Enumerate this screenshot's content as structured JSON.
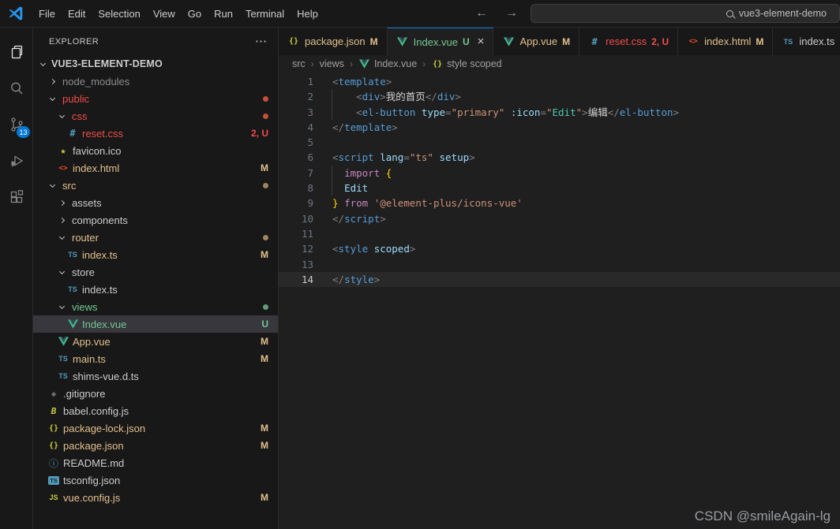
{
  "colors": {
    "accent_blue": "#0078d4",
    "git_modified": "#e2c08d",
    "git_untracked": "#73c991",
    "error_red": "#f14c4c",
    "vue_green": "#41b883"
  },
  "title_bar": {
    "menus": [
      "File",
      "Edit",
      "Selection",
      "View",
      "Go",
      "Run",
      "Terminal",
      "Help"
    ],
    "back_arrow": "←",
    "forward_arrow": "→",
    "search_text": "vue3-element-demo"
  },
  "activity_bar": {
    "source_control_badge": "13"
  },
  "explorer": {
    "header": "EXPLORER",
    "actions": "⋯",
    "root": "VUE3-ELEMENT-DEMO",
    "items": [
      {
        "label": "node_modules",
        "type": "folder",
        "expanded": false,
        "level": 1,
        "color": "gray"
      },
      {
        "label": "public",
        "type": "folder",
        "expanded": true,
        "level": 1,
        "color": "red",
        "dot": "red"
      },
      {
        "label": "css",
        "type": "folder",
        "expanded": true,
        "level": 2,
        "color": "red",
        "dot": "red"
      },
      {
        "label": "reset.css",
        "type": "file",
        "icon": "hash",
        "level": 3,
        "color": "red",
        "badge": "2, U",
        "badge_color": "red"
      },
      {
        "label": "favicon.ico",
        "type": "file",
        "icon": "star",
        "level": 2,
        "color": "default"
      },
      {
        "label": "index.html",
        "type": "file",
        "icon": "html",
        "level": 2,
        "color": "modified",
        "badge": "M",
        "badge_color": "modified"
      },
      {
        "label": "src",
        "type": "folder",
        "expanded": true,
        "level": 1,
        "color": "modified",
        "dot": "modified"
      },
      {
        "label": "assets",
        "type": "folder",
        "expanded": false,
        "level": 2,
        "color": "default"
      },
      {
        "label": "components",
        "type": "folder",
        "expanded": false,
        "level": 2,
        "color": "default"
      },
      {
        "label": "router",
        "type": "folder",
        "expanded": true,
        "level": 2,
        "color": "modified",
        "dot": "modified"
      },
      {
        "label": "index.ts",
        "type": "file",
        "icon": "ts",
        "level": 3,
        "color": "modified",
        "badge": "M",
        "badge_color": "modified"
      },
      {
        "label": "store",
        "type": "folder",
        "expanded": true,
        "level": 2,
        "color": "default"
      },
      {
        "label": "index.ts",
        "type": "file",
        "icon": "ts",
        "level": 3,
        "color": "default"
      },
      {
        "label": "views",
        "type": "folder",
        "expanded": true,
        "level": 2,
        "color": "untracked",
        "dot": "untracked"
      },
      {
        "label": "Index.vue",
        "type": "file",
        "icon": "vue",
        "level": 3,
        "color": "untracked",
        "badge": "U",
        "badge_color": "untracked",
        "selected": true
      },
      {
        "label": "App.vue",
        "type": "file",
        "icon": "vue",
        "level": 2,
        "color": "modified",
        "badge": "M",
        "badge_color": "modified"
      },
      {
        "label": "main.ts",
        "type": "file",
        "icon": "ts",
        "level": 2,
        "color": "modified",
        "badge": "M",
        "badge_color": "modified"
      },
      {
        "label": "shims-vue.d.ts",
        "type": "file",
        "icon": "ts",
        "level": 2,
        "color": "default"
      },
      {
        "label": ".gitignore",
        "type": "file",
        "icon": "git",
        "level": 1,
        "color": "default"
      },
      {
        "label": "babel.config.js",
        "type": "file",
        "icon": "babel",
        "level": 1,
        "color": "default"
      },
      {
        "label": "package-lock.json",
        "type": "file",
        "icon": "braces",
        "level": 1,
        "color": "modified",
        "badge": "M",
        "badge_color": "modified"
      },
      {
        "label": "package.json",
        "type": "file",
        "icon": "braces",
        "level": 1,
        "color": "modified",
        "badge": "M",
        "badge_color": "modified"
      },
      {
        "label": "README.md",
        "type": "file",
        "icon": "info",
        "level": 1,
        "color": "default"
      },
      {
        "label": "tsconfig.json",
        "type": "file",
        "icon": "tsjson",
        "level": 1,
        "color": "default"
      },
      {
        "label": "vue.config.js",
        "type": "file",
        "icon": "js",
        "level": 1,
        "color": "modified",
        "badge": "M",
        "badge_color": "modified"
      }
    ]
  },
  "tabs": [
    {
      "label": "package.json",
      "icon": "braces",
      "color": "modified",
      "badge": "M",
      "active": false
    },
    {
      "label": "Index.vue",
      "icon": "vue",
      "color": "untracked",
      "badge": "U",
      "active": true,
      "close": "×"
    },
    {
      "label": "App.vue",
      "icon": "vue",
      "color": "modified",
      "badge": "M",
      "active": false
    },
    {
      "label": "reset.css",
      "icon": "hash",
      "color": "red",
      "badge": "2, U",
      "active": false
    },
    {
      "label": "index.html",
      "icon": "html",
      "color": "modified",
      "badge": "M",
      "active": false
    },
    {
      "label": "index.ts",
      "icon": "ts",
      "color": "default",
      "badge": "",
      "active": false
    }
  ],
  "breadcrumb": [
    {
      "label": "src"
    },
    {
      "label": "views"
    },
    {
      "label": "Index.vue",
      "icon": "vue"
    },
    {
      "label": "style scoped",
      "icon": "braces"
    }
  ],
  "editor": {
    "current_line": 14,
    "lines": [
      {
        "n": 1,
        "t": [
          [
            "<",
            "p"
          ],
          [
            "template",
            "tag"
          ],
          [
            ">",
            "p"
          ]
        ]
      },
      {
        "n": 2,
        "g": true,
        "t": [
          [
            "    ",
            "w"
          ],
          [
            "<",
            "p"
          ],
          [
            "div",
            "tag"
          ],
          [
            ">",
            "p"
          ],
          [
            "我的首页",
            "txt"
          ],
          [
            "</",
            "p"
          ],
          [
            "div",
            "tag"
          ],
          [
            ">",
            "p"
          ]
        ]
      },
      {
        "n": 3,
        "g": true,
        "t": [
          [
            "    ",
            "w"
          ],
          [
            "<",
            "p"
          ],
          [
            "el-button",
            "tag"
          ],
          [
            " ",
            "w"
          ],
          [
            "type",
            "attr"
          ],
          [
            "=",
            "p"
          ],
          [
            "\"primary\"",
            "str"
          ],
          [
            " ",
            "w"
          ],
          [
            ":icon",
            "attr"
          ],
          [
            "=",
            "p"
          ],
          [
            "\"",
            "str"
          ],
          [
            "Edit",
            "type"
          ],
          [
            "\"",
            "str"
          ],
          [
            ">",
            "p"
          ],
          [
            "编辑",
            "txt"
          ],
          [
            "</",
            "p"
          ],
          [
            "el-button",
            "tag"
          ],
          [
            ">",
            "p"
          ]
        ]
      },
      {
        "n": 4,
        "t": [
          [
            "</",
            "p"
          ],
          [
            "template",
            "tag"
          ],
          [
            ">",
            "p"
          ]
        ]
      },
      {
        "n": 5,
        "t": []
      },
      {
        "n": 6,
        "t": [
          [
            "<",
            "p"
          ],
          [
            "script",
            "tag"
          ],
          [
            " ",
            "w"
          ],
          [
            "lang",
            "attr"
          ],
          [
            "=",
            "p"
          ],
          [
            "\"ts\"",
            "str"
          ],
          [
            " ",
            "w"
          ],
          [
            "setup",
            "attr"
          ],
          [
            ">",
            "p"
          ]
        ]
      },
      {
        "n": 7,
        "g": true,
        "t": [
          [
            "  ",
            "w"
          ],
          [
            "import",
            "kw"
          ],
          [
            " ",
            "w"
          ],
          [
            "{",
            "br"
          ]
        ]
      },
      {
        "n": 8,
        "g": true,
        "t": [
          [
            "  ",
            "w"
          ],
          [
            "Edit",
            "var"
          ]
        ]
      },
      {
        "n": 9,
        "t": [
          [
            "}",
            "br"
          ],
          [
            " ",
            "w"
          ],
          [
            "from",
            "kw"
          ],
          [
            " ",
            "w"
          ],
          [
            "'@element-plus/icons-vue'",
            "str"
          ]
        ]
      },
      {
        "n": 10,
        "t": [
          [
            "</",
            "p"
          ],
          [
            "script",
            "tag"
          ],
          [
            ">",
            "p"
          ]
        ]
      },
      {
        "n": 11,
        "t": []
      },
      {
        "n": 12,
        "t": [
          [
            "<",
            "p"
          ],
          [
            "style",
            "tag"
          ],
          [
            " ",
            "w"
          ],
          [
            "scoped",
            "attr"
          ],
          [
            ">",
            "p"
          ]
        ]
      },
      {
        "n": 13,
        "t": []
      },
      {
        "n": 14,
        "t": [
          [
            "</",
            "p"
          ],
          [
            "style",
            "tag"
          ],
          [
            ">",
            "p"
          ]
        ]
      }
    ]
  },
  "watermark": "CSDN @smileAgain-lg"
}
